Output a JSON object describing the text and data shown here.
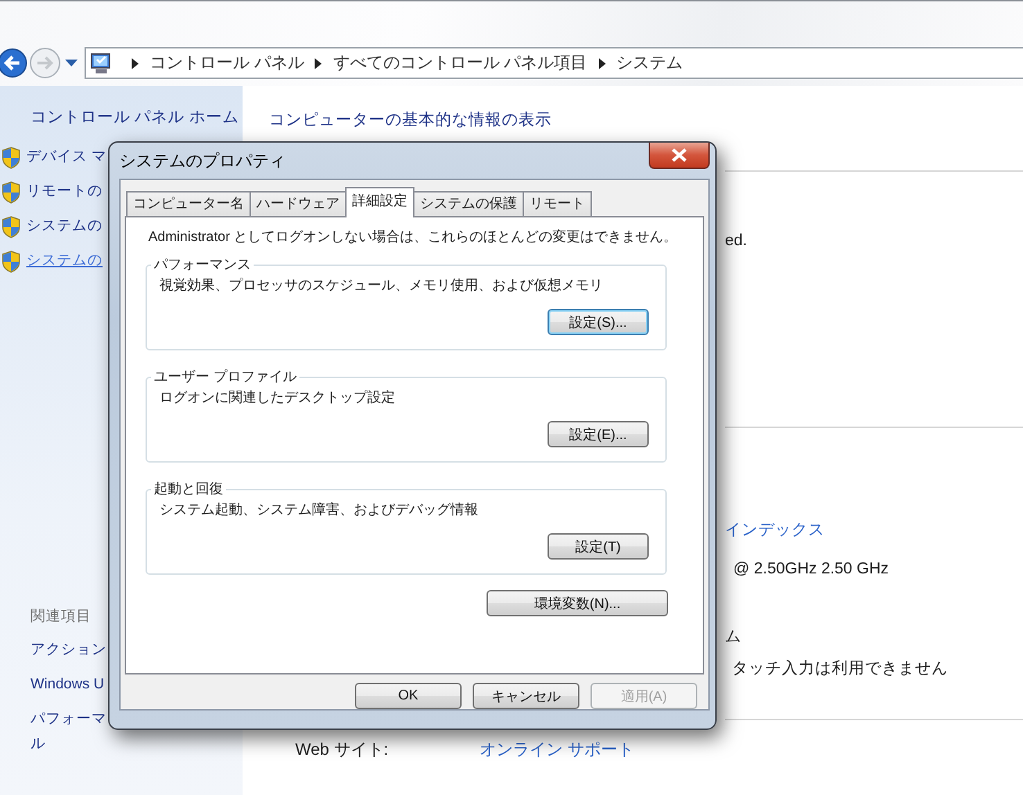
{
  "navigation": {
    "breadcrumbs": [
      "コントロール パネル",
      "すべてのコントロール パネル項目",
      "システム"
    ]
  },
  "sidebar": {
    "home_link": "コントロール パネル ホーム",
    "tasks": [
      {
        "label": "デバイス マ",
        "hovered": false
      },
      {
        "label": "リモートの",
        "hovered": false
      },
      {
        "label": "システムの",
        "hovered": false
      },
      {
        "label": "システムの",
        "hovered": true
      }
    ],
    "related_heading": "関連項目",
    "related_links": [
      {
        "lines": [
          "アクション"
        ]
      },
      {
        "lines": [
          "Windows U"
        ]
      },
      {
        "lines": [
          "パフォーマ",
          "ル"
        ]
      }
    ]
  },
  "main": {
    "heading": "コンピューターの基本的な情報の表示",
    "fragments": [
      {
        "kind": "text",
        "text": "ed."
      },
      {
        "kind": "link",
        "text": "インデックス"
      },
      {
        "kind": "text",
        "text": "@ 2.50GHz   2.50 GHz"
      },
      {
        "kind": "text",
        "text": "ム"
      },
      {
        "kind": "text",
        "text": "タッチ入力は利用できません"
      }
    ],
    "web_site": {
      "label": "Web サイト:",
      "link": "オンライン サポート"
    }
  },
  "dialog": {
    "title": "システムのプロパティ",
    "tabs": [
      {
        "label": "コンピューター名",
        "selected": false
      },
      {
        "label": "ハードウェア",
        "selected": false
      },
      {
        "label": "詳細設定",
        "selected": true
      },
      {
        "label": "システムの保護",
        "selected": false
      },
      {
        "label": "リモート",
        "selected": false
      }
    ],
    "notice": "Administrator としてログオンしない場合は、これらのほとんどの変更はできません。",
    "groups": [
      {
        "title": "パフォーマンス",
        "description": "視覚効果、プロセッサのスケジュール、メモリ使用、および仮想メモリ",
        "button": "設定(S)...",
        "focused": true
      },
      {
        "title": "ユーザー プロファイル",
        "description": "ログオンに関連したデスクトップ設定",
        "button": "設定(E)...",
        "focused": false
      },
      {
        "title": "起動と回復",
        "description": "システム起動、システム障害、およびデバッグ情報",
        "button": "設定(T)",
        "focused": false
      }
    ],
    "env_button": "環境変数(N)...",
    "buttons": [
      {
        "label": "OK",
        "disabled": false
      },
      {
        "label": "キャンセル",
        "disabled": false
      },
      {
        "label": "適用(A)",
        "disabled": true
      }
    ]
  }
}
